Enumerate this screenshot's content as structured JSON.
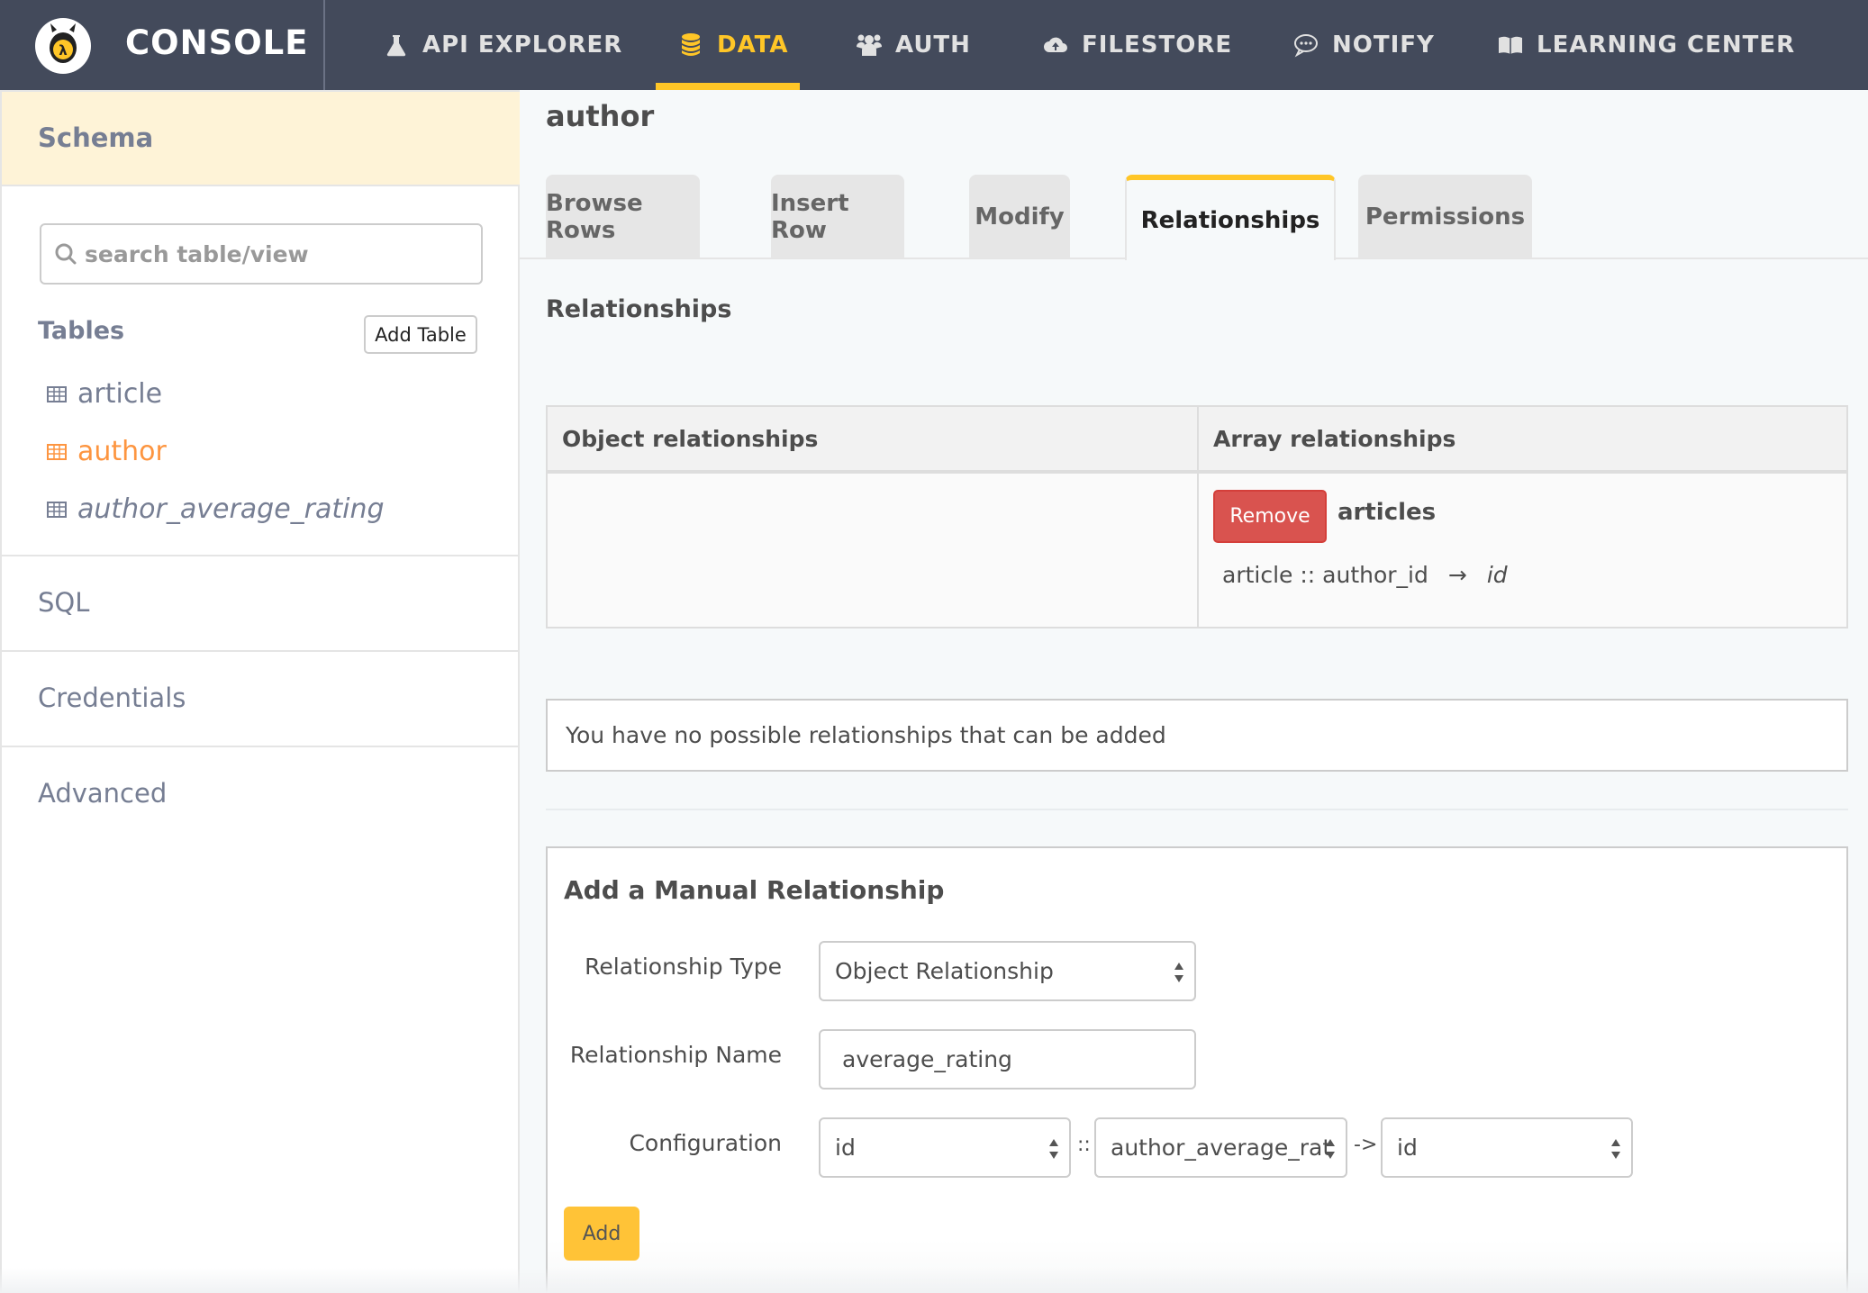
{
  "app": {
    "brand": "CONSOLE",
    "logo_icon": "hasura-lambda-logo-icon"
  },
  "colors": {
    "nav_bg": "#434a5b",
    "accent": "#ffc627",
    "sidebar_active": "#fd9540",
    "danger": "#d9534f",
    "schema_header_bg": "#fef3d7"
  },
  "nav": {
    "items": [
      {
        "label": "API EXPLORER",
        "icon": "flask-icon",
        "active": false
      },
      {
        "label": "DATA",
        "icon": "database-icon",
        "active": true
      },
      {
        "label": "AUTH",
        "icon": "users-icon",
        "active": false
      },
      {
        "label": "FILESTORE",
        "icon": "cloud-upload-icon",
        "active": false
      },
      {
        "label": "NOTIFY",
        "icon": "chat-bubble-icon",
        "active": false
      },
      {
        "label": "LEARNING CENTER",
        "icon": "book-open-icon",
        "active": false
      }
    ]
  },
  "sidebar": {
    "schema_label": "Schema",
    "search_placeholder": "search table/view",
    "tables_label": "Tables",
    "add_table_label": "Add Table",
    "tables": [
      {
        "name": "article",
        "active": false,
        "is_view": false
      },
      {
        "name": "author",
        "active": true,
        "is_view": false
      },
      {
        "name": "author_average_rating",
        "active": false,
        "is_view": true
      }
    ],
    "links": [
      {
        "label": "SQL"
      },
      {
        "label": "Credentials"
      },
      {
        "label": "Advanced"
      }
    ]
  },
  "main": {
    "title": "author",
    "tabs": [
      {
        "label": "Browse Rows",
        "active": false
      },
      {
        "label": "Insert Row",
        "active": false
      },
      {
        "label": "Modify",
        "active": false
      },
      {
        "label": "Relationships",
        "active": true
      },
      {
        "label": "Permissions",
        "active": false
      }
    ],
    "section_title": "Relationships",
    "relationships_table": {
      "headers": [
        "Object relationships",
        "Array relationships"
      ],
      "object_relationships": [],
      "array_relationships": [
        {
          "remove_label": "Remove",
          "name": "articles",
          "source": "article :: author_id",
          "arrow": "→",
          "target": "id"
        }
      ]
    },
    "suggestions_notice": "You have no possible relationships that can be added",
    "manual": {
      "title": "Add a Manual Relationship",
      "type_label": "Relationship Type",
      "type_value": "Object Relationship",
      "name_label": "Relationship Name",
      "name_value": "average_rating",
      "config_label": "Configuration",
      "config_lcol": "id",
      "config_sep1": "::",
      "config_rtable": "author_average_rat",
      "config_sep2": "->",
      "config_rcol": "id",
      "add_label": "Add"
    }
  }
}
